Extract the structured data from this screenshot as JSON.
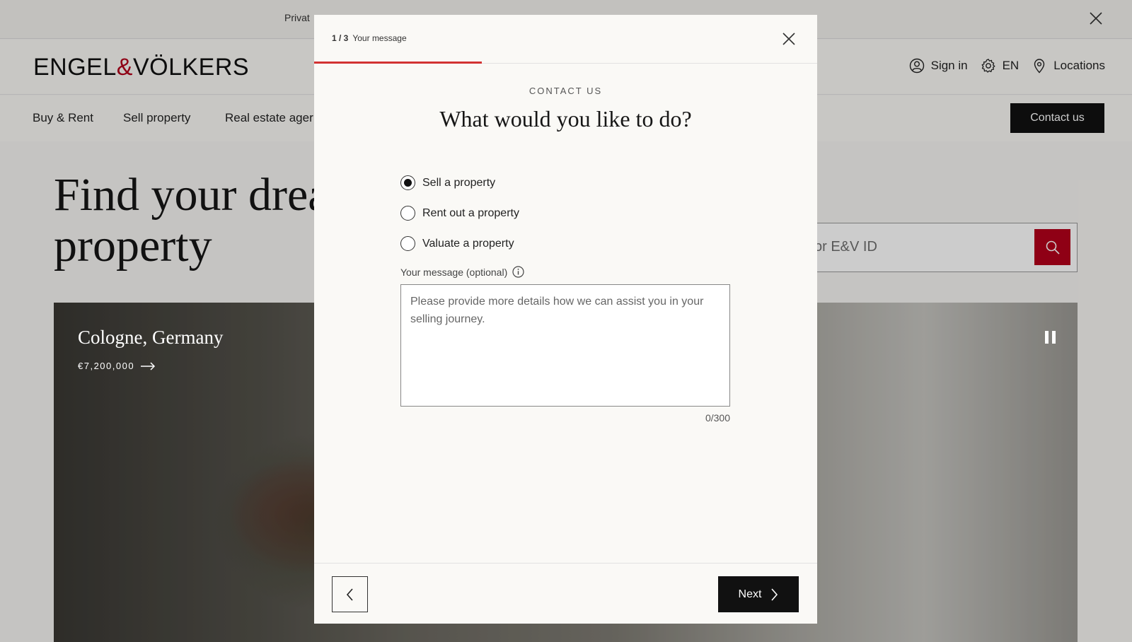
{
  "banner": {
    "text": "Privat"
  },
  "header": {
    "logo_left": "ENGEL",
    "logo_amp": "&",
    "logo_right": "VÖLKERS",
    "sign_in": "Sign in",
    "language": "EN",
    "locations": "Locations"
  },
  "nav": {
    "items": [
      "Buy & Rent",
      "Sell property",
      "Real estate ager"
    ],
    "contact": "Contact us"
  },
  "hero": {
    "title_line1": "Find your drea",
    "title_line2": "property",
    "search_placeholder": "or E&V ID",
    "location": "Cologne, Germany",
    "price": "€7,200,000"
  },
  "modal": {
    "step_number": "1 / 3",
    "step_title": "Your message",
    "progress_fraction": 0.3333,
    "eyebrow": "CONTACT US",
    "question": "What would you like to do?",
    "options": [
      {
        "label": "Sell a property",
        "checked": true
      },
      {
        "label": "Rent out a property",
        "checked": false
      },
      {
        "label": "Valuate a property",
        "checked": false
      }
    ],
    "message_label": "Your message (optional)",
    "message_placeholder": "Please provide more details how we can assist you in your selling journey.",
    "message_value": "",
    "counter": "0/300",
    "next": "Next"
  },
  "colors": {
    "brand_red": "#b3001b",
    "progress_red": "#d23232",
    "dark": "#111111"
  },
  "icons": {
    "banner_close": "close-icon",
    "sign_in": "user-icon",
    "language": "gear-icon",
    "locations": "location-pin-icon",
    "search": "search-icon",
    "price_arrow": "arrow-right-icon",
    "pause": "pause-icon",
    "modal_close": "close-icon",
    "info": "info-icon",
    "back": "chevron-left-icon",
    "next": "chevron-right-icon"
  }
}
